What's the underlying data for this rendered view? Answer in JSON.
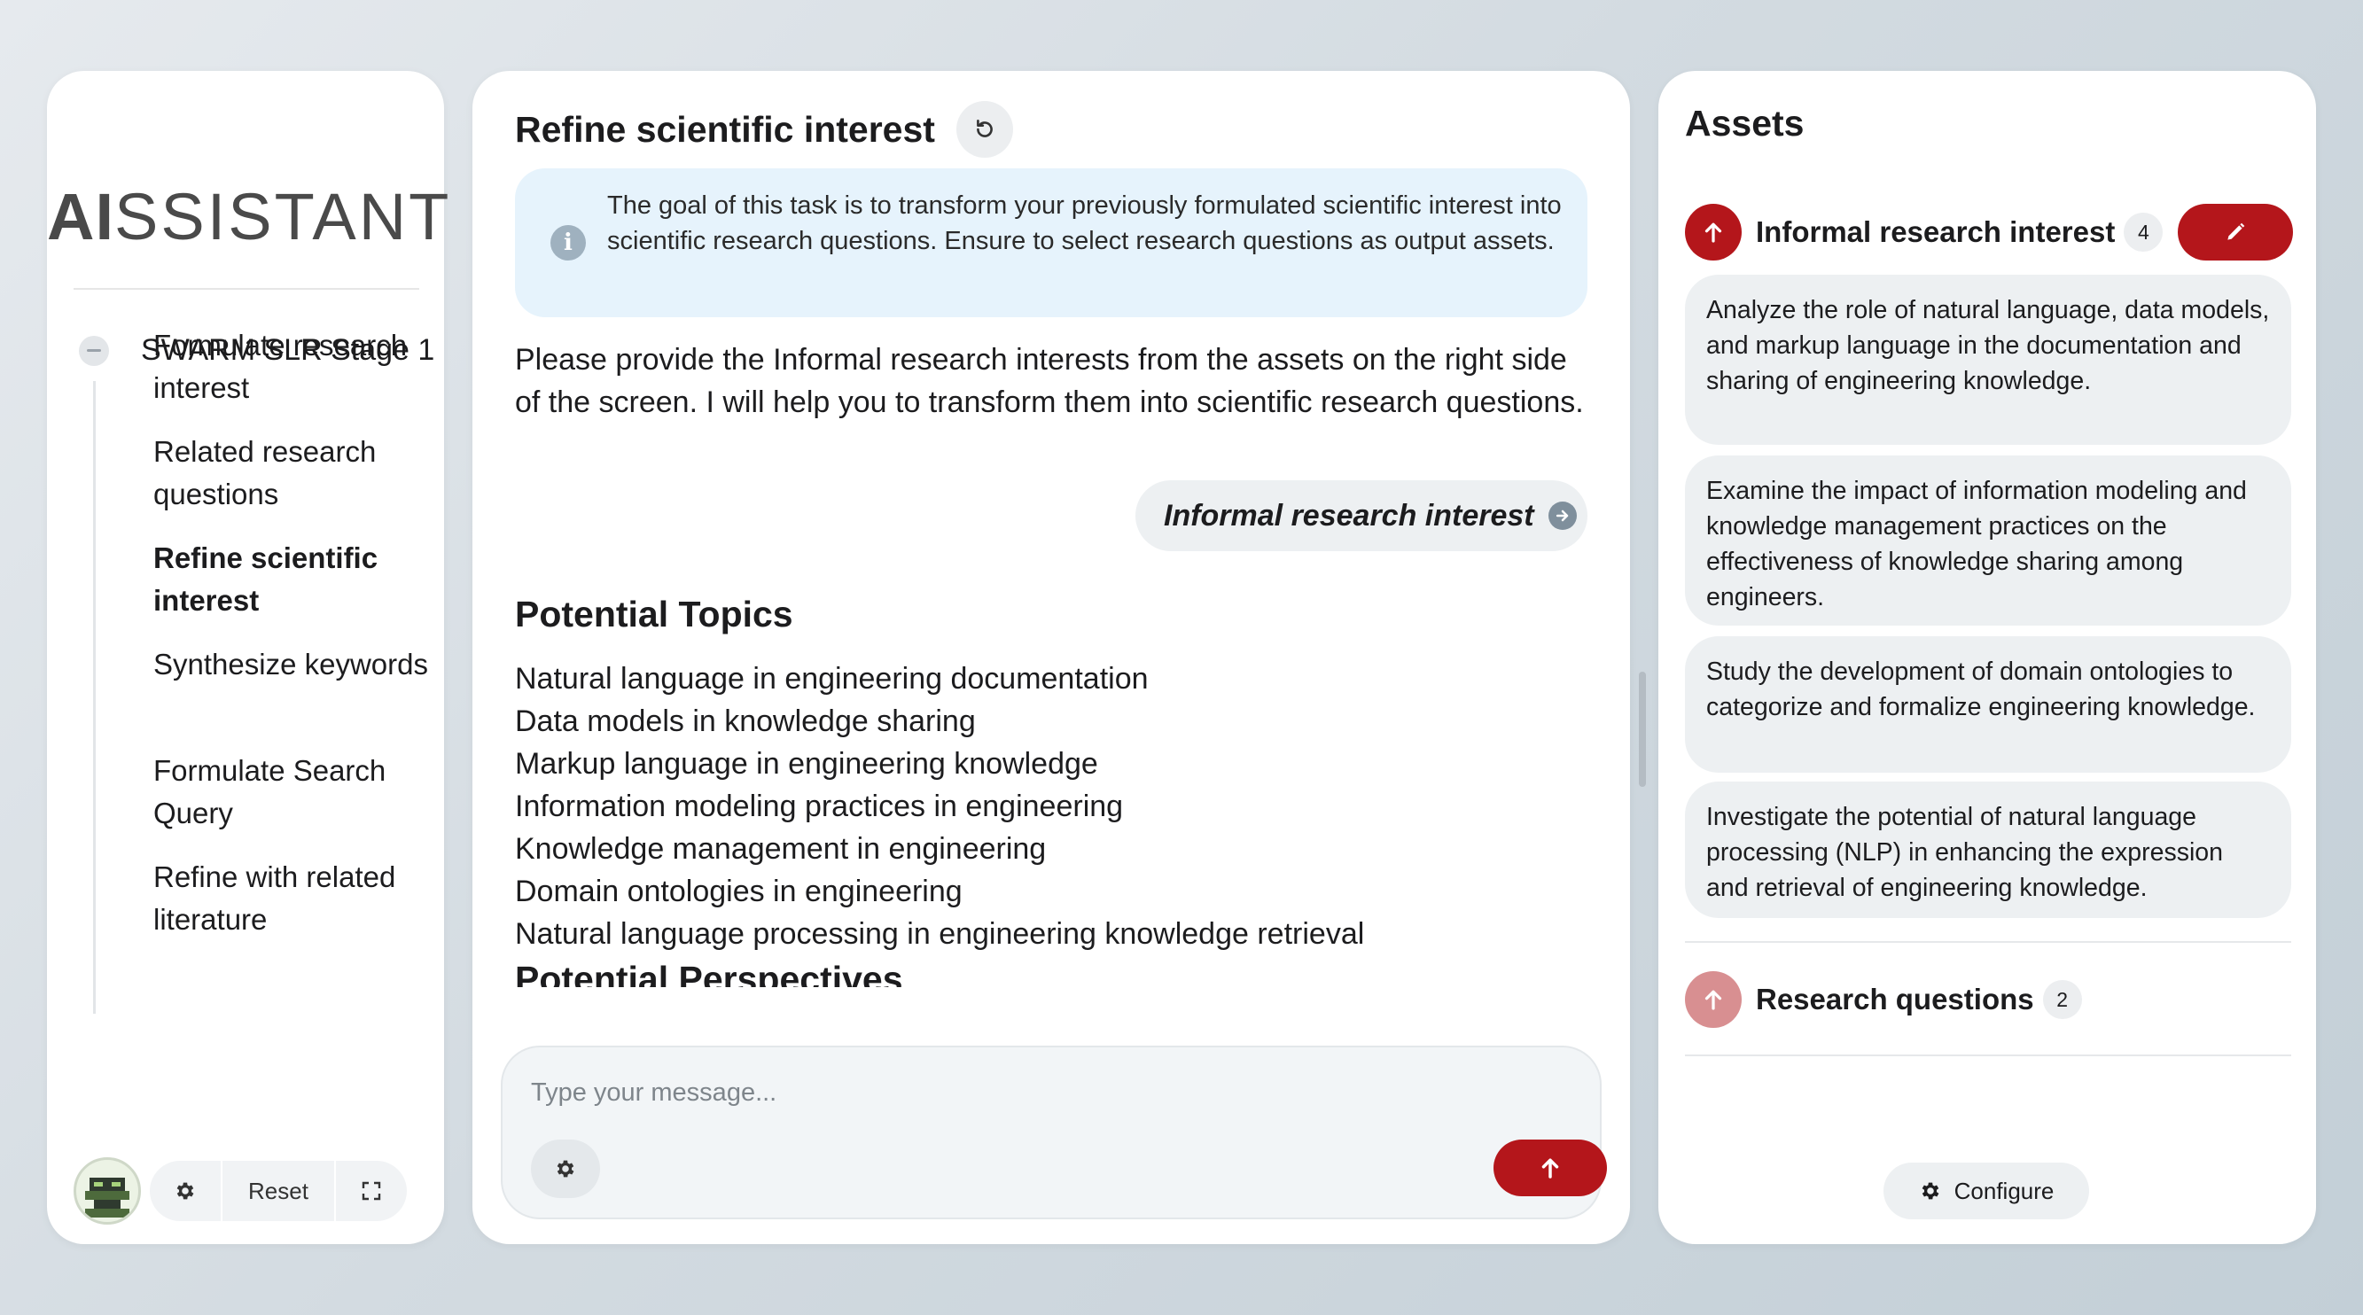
{
  "sidebar": {
    "logo_ai": "AI",
    "logo_rest": "SSISTANT",
    "stage_title": "SWARM SLR Stage 1",
    "steps": [
      {
        "label": "Formulate research interest"
      },
      {
        "label": "Related research questions"
      },
      {
        "label": "Refine scientific interest"
      },
      {
        "label": "Synthesize keywords"
      },
      {
        "label": "Formulate Search Query"
      },
      {
        "label": "Refine with related literature"
      }
    ],
    "active_step": "Refine scientific interest",
    "reset_label": "Reset",
    "icons": {
      "settings": "gear-icon",
      "fullscreen": "expand-icon",
      "collapse": "minus-circle-icon",
      "avatar": "pixel-robot-avatar"
    }
  },
  "chat": {
    "title": "Refine scientific interest",
    "info": "The goal of this task is to transform your previously formulated scientific interest into scientific research questions. Ensure to select research questions as output assets.",
    "prompt": "Please provide the Informal research interests from the assets on the right side of the screen. I will help you to transform them into scientific research questions.",
    "asset_chip": "Informal research interest",
    "topics_heading": "Potential Topics",
    "topics": [
      "Natural language in engineering documentation",
      "Data models in knowledge sharing",
      "Markup language in engineering knowledge",
      "Information modeling practices in engineering",
      "Knowledge management in engineering",
      "Domain ontologies in engineering",
      "Natural language processing in engineering knowledge retrieval"
    ],
    "perspectives_heading": "Potential Perspectives",
    "composer_placeholder": "Type your message..."
  },
  "assets": {
    "title": "Assets",
    "groups": [
      {
        "label": "Informal research interest",
        "count": "4",
        "items": [
          "Analyze the role of natural language, data models, and markup language in the documentation and sharing of engineering knowledge.",
          "Examine the impact of information modeling and knowledge management practices on the effectiveness of knowledge sharing among engineers.",
          "Study the development of domain ontologies to categorize and formalize engineering knowledge.",
          "Investigate the potential of natural language processing (NLP) in enhancing the expression and retrieval of engineering knowledge."
        ]
      },
      {
        "label": "Research questions",
        "count": "2",
        "items": []
      }
    ],
    "configure_label": "Configure"
  },
  "colors": {
    "accent_red": "#b4161b",
    "accent_red_faded": "#d88f91",
    "info_bg": "#e6f3fc",
    "chip_bg": "#edf0f2"
  }
}
